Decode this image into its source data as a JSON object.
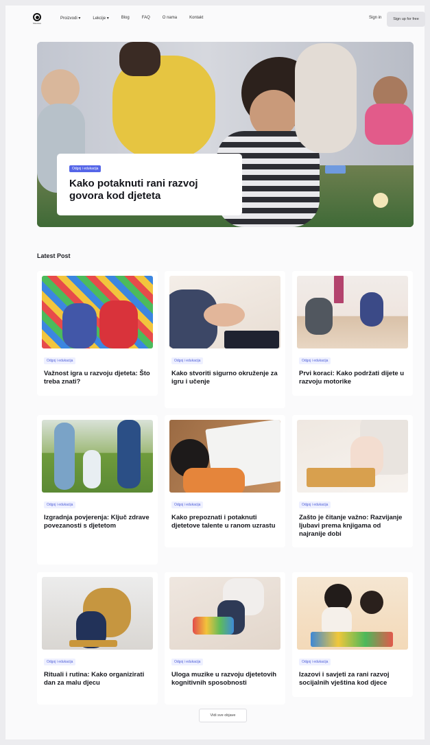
{
  "nav": {
    "logo_text": "Sitewave",
    "items": [
      "Proizvodi ▾",
      "Lekcije ▾",
      "Blog",
      "FAQ",
      "O nama",
      "Kontakt"
    ],
    "sign_in": "Sign in",
    "sign_up": "Sign up for free"
  },
  "hero": {
    "badge": "Odgoj i edukacija",
    "title": "Kako potaknuti rani razvoj govora kod djeteta"
  },
  "latest": {
    "title": "Latest Post",
    "posts": [
      {
        "badge": "Odgoj i edukacija",
        "title": "Važnost igra u razvoju djeteta: Što treba znati?"
      },
      {
        "badge": "Odgoj i edukacija",
        "title": "Kako stvoriti sigurno okruženje za igru i učenje"
      },
      {
        "badge": "Odgoj i edukacija",
        "title": "Prvi koraci: Kako podržati dijete u razvoju motorike"
      },
      {
        "badge": "Odgoj i edukacija",
        "title": "Izgradnja povjerenja: Ključ zdrave povezanosti s djetetom"
      },
      {
        "badge": "Odgoj i edukacija",
        "title": "Kako prepoznati i potaknuti djetetove talente u ranom uzrastu"
      },
      {
        "badge": "Odgoj i edukacija",
        "title": "Zašto je čitanje važno: Razvijanje ljubavi prema knjigama od najranije dobi"
      },
      {
        "badge": "Odgoj i edukacija",
        "title": "Rituali i rutina: Kako organizirati dan za malu djecu"
      },
      {
        "badge": "Odgoj i edukacija",
        "title": "Uloga muzike u razvoju djetetovih kognitivnih sposobnosti"
      },
      {
        "badge": "Odgoj i edukacija",
        "title": "Izazovi i savjeti za rani razvoj socijalnih vještina kod djece"
      }
    ],
    "view_all": "Vidi sve objave"
  }
}
